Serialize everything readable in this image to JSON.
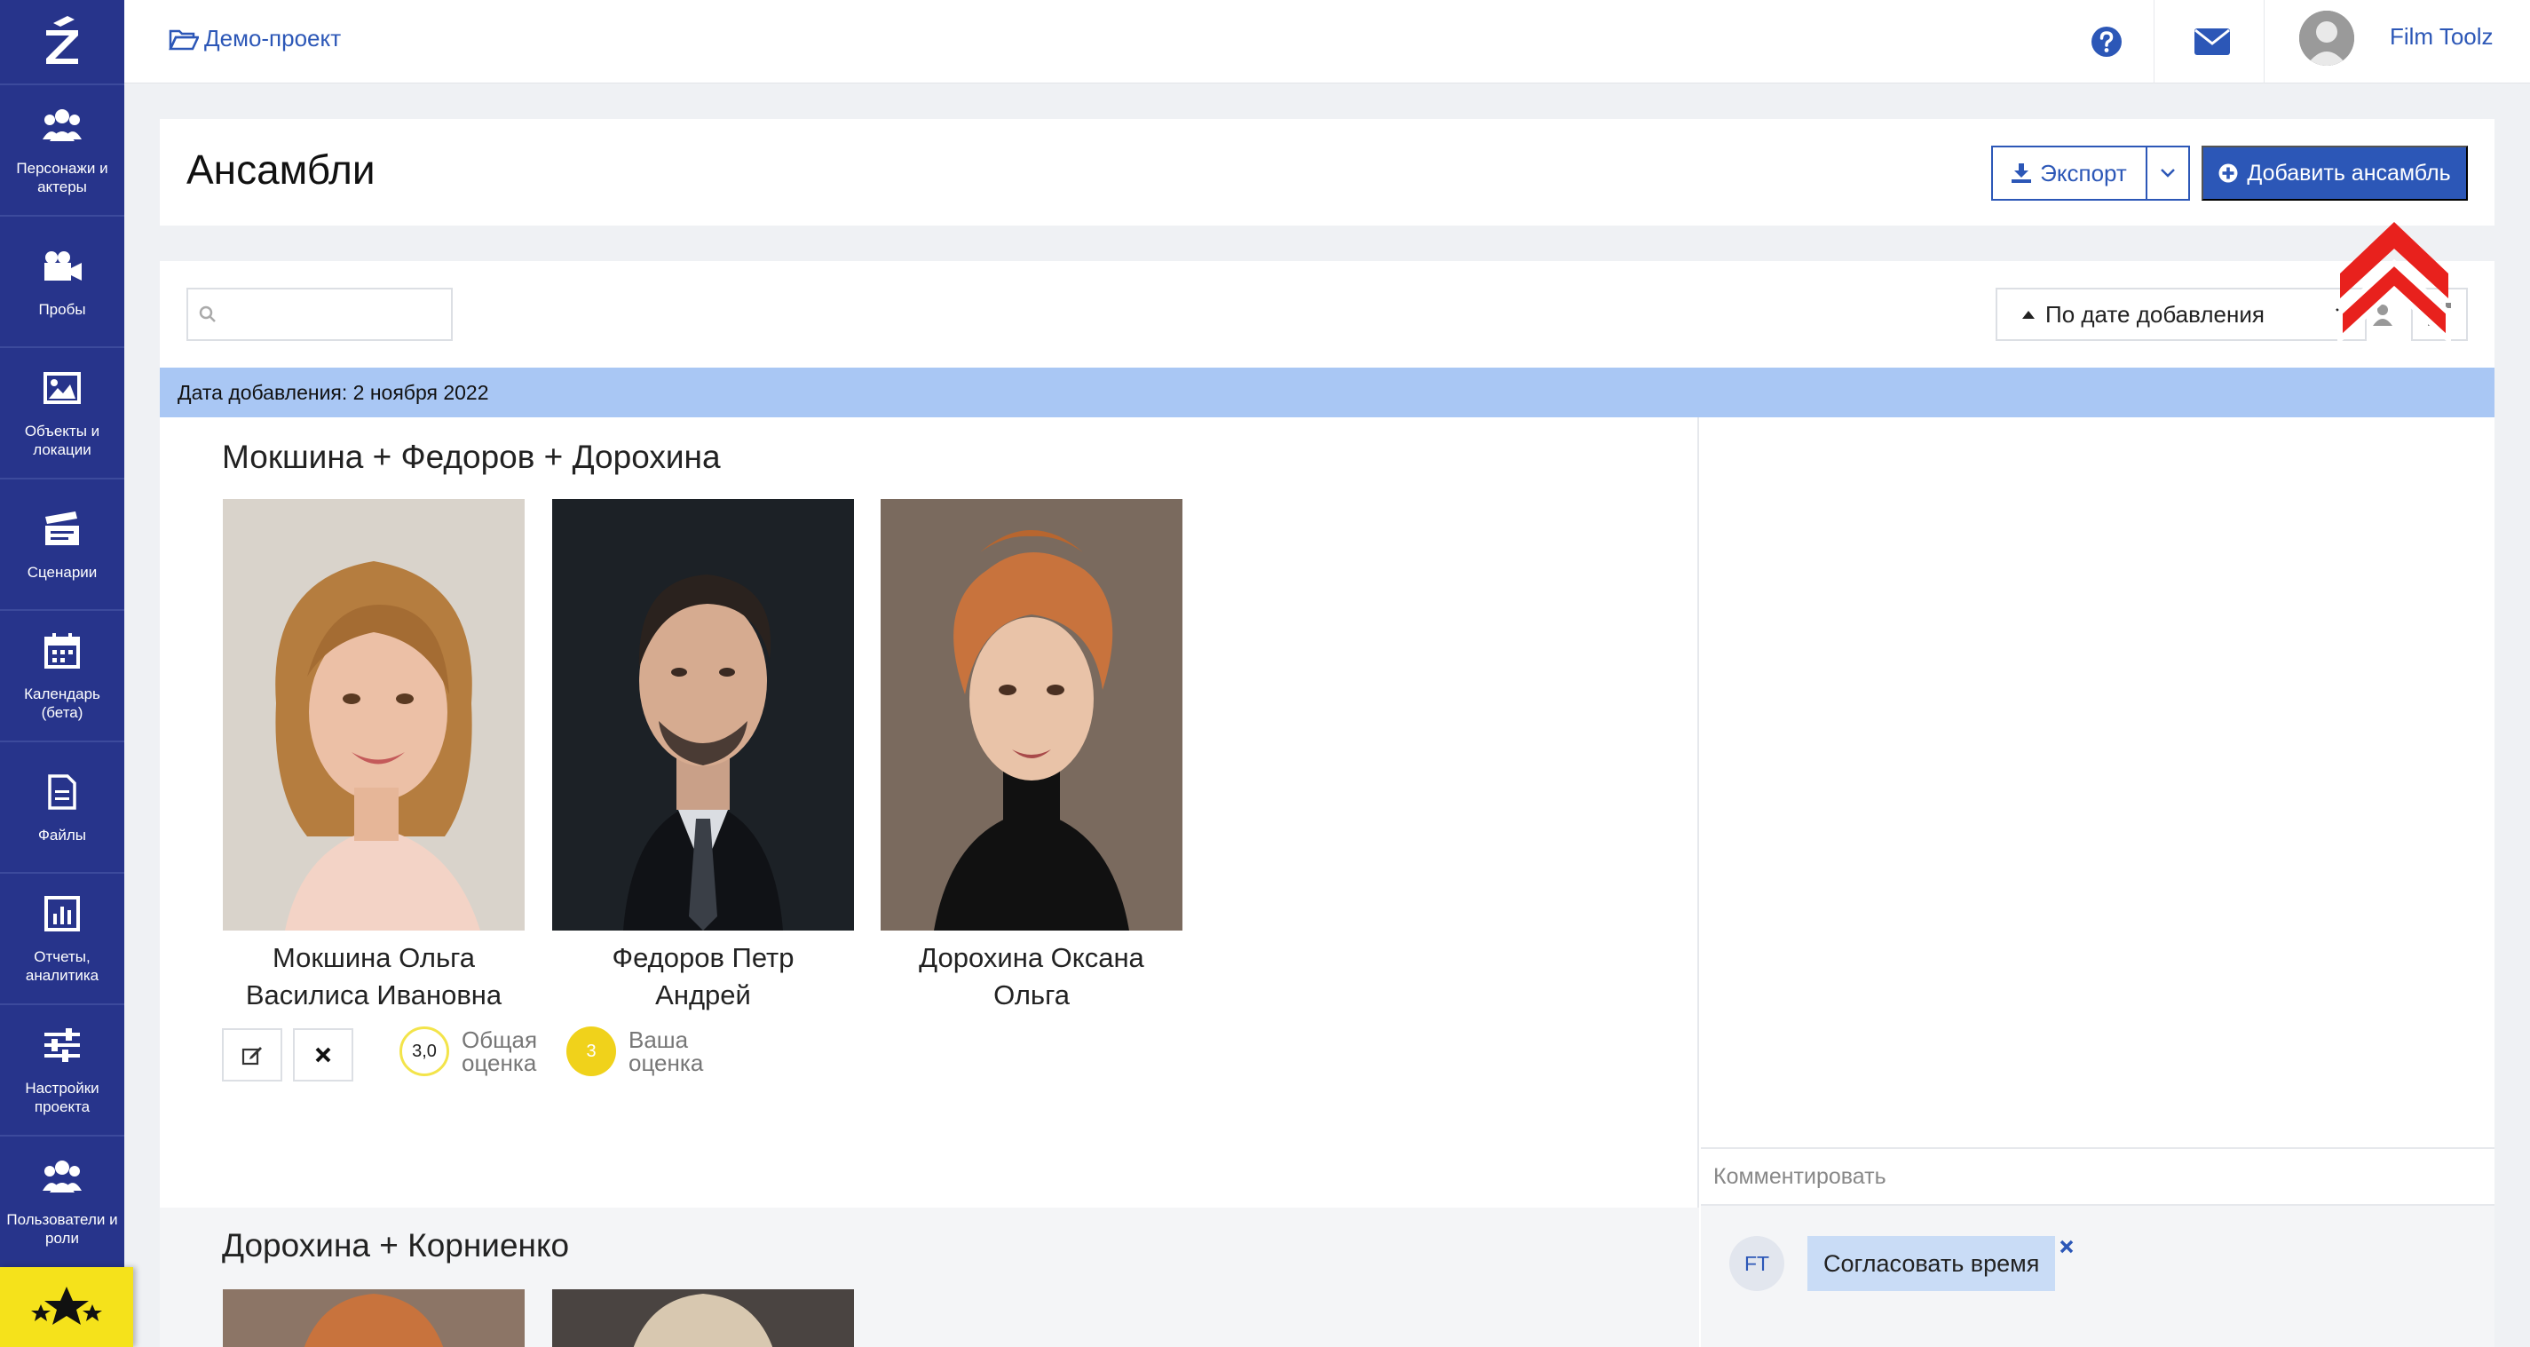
{
  "sidebar": {
    "items": [
      {
        "label": "Персонажи и актеры",
        "icon": "users-icon"
      },
      {
        "label": "Пробы",
        "icon": "video-camera-icon"
      },
      {
        "label": "Объекты и локации",
        "icon": "image-icon"
      },
      {
        "label": "Сценарии",
        "icon": "clapperboard-icon"
      },
      {
        "label": "Календарь (бета)",
        "icon": "calendar-icon"
      },
      {
        "label": "Файлы",
        "icon": "file-icon"
      },
      {
        "label": "Отчеты, аналитика",
        "icon": "bar-chart-icon"
      },
      {
        "label": "Настройки проекта",
        "icon": "sliders-icon"
      },
      {
        "label": "Пользователи и роли",
        "icon": "users-icon"
      }
    ]
  },
  "topbar": {
    "project": "Демо-проект",
    "user_name": "Film Toolz"
  },
  "header": {
    "title": "Ансамбли",
    "export_label": "Экспорт",
    "add_label": "Добавить ансамбль"
  },
  "toolbar": {
    "search_placeholder": "",
    "sort_label": "По дате добавления"
  },
  "group": {
    "date_label": "Дата добавления: 2 ноября 2022"
  },
  "ensemble": {
    "title": "Мокшина + Федоров + Дорохина",
    "actors": [
      {
        "name": "Мокшина Ольга",
        "role": "Василиса Ивановна"
      },
      {
        "name": "Федоров Петр",
        "role": "Андрей"
      },
      {
        "name": "Дорохина Оксана",
        "role": "Ольга"
      }
    ],
    "total_rating": "3,0",
    "total_label_1": "Общая",
    "total_label_2": "оценка",
    "my_rating": "3",
    "my_label_1": "Ваша",
    "my_label_2": "оценка"
  },
  "comments": {
    "placeholder": "Комментировать",
    "author_initials": "FT",
    "tag": "Согласовать время"
  },
  "ensemble2": {
    "title": "Дорохина + Корниенко"
  },
  "colors": {
    "sidebar": "#27348b",
    "accent": "#2c57b7",
    "band": "#a9c7f4",
    "rating": "#f0d21b",
    "marker": "#e8211d"
  }
}
